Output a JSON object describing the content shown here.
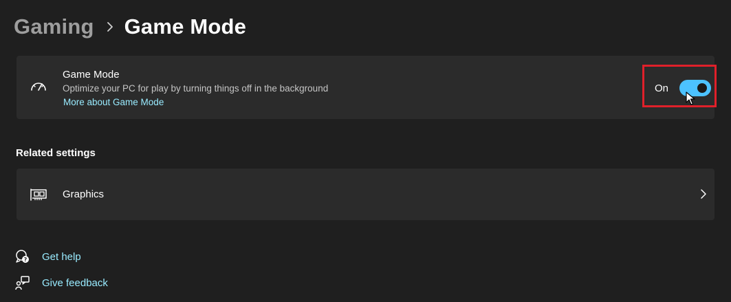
{
  "breadcrumb": {
    "parent": "Gaming",
    "current": "Game Mode"
  },
  "game_mode_card": {
    "title": "Game Mode",
    "description": "Optimize your PC for play by turning things off in the background",
    "link": "More about Game Mode",
    "toggle_state_label": "On",
    "toggle_on": true,
    "icon": "speedometer-icon"
  },
  "related_settings": {
    "title": "Related settings",
    "items": [
      {
        "label": "Graphics",
        "icon": "graphics-card-icon"
      }
    ]
  },
  "footer": {
    "get_help": "Get help",
    "give_feedback": "Give feedback"
  },
  "colors": {
    "background": "#1f1f1f",
    "card": "#2b2b2b",
    "accent": "#4cc2ff",
    "link": "#99ebff",
    "highlight": "#e0202a"
  }
}
